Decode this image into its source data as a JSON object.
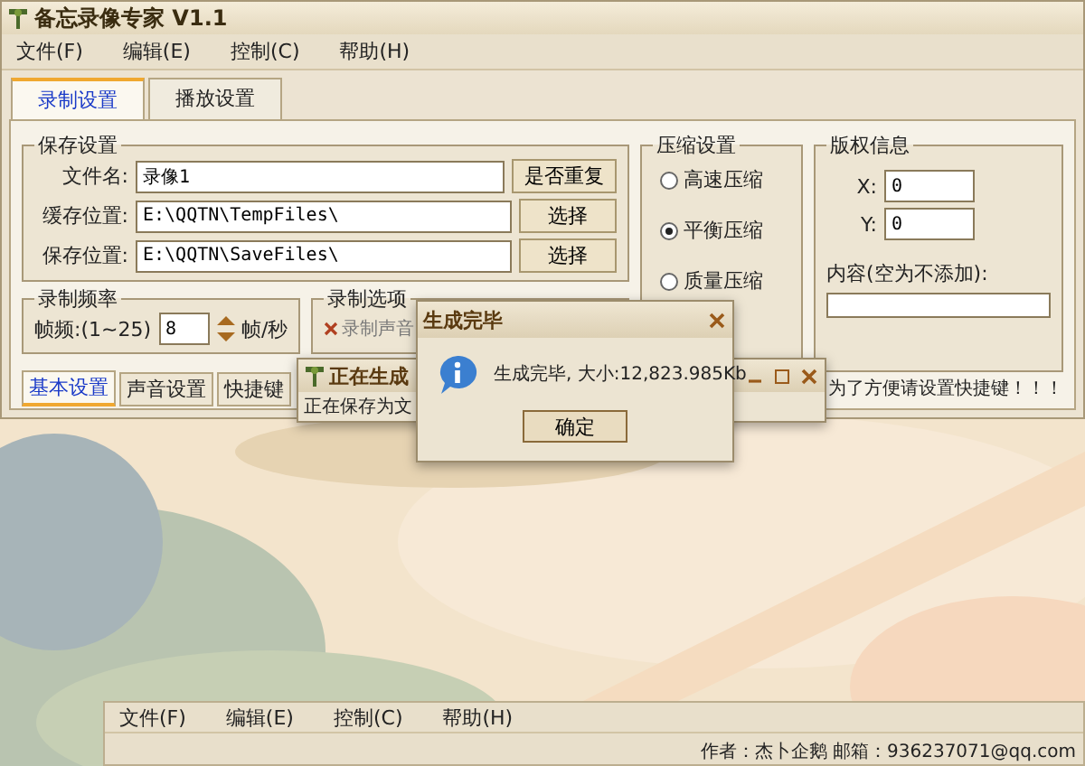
{
  "window": {
    "title": "备忘录像专家 V1.1"
  },
  "menu": [
    "文件(F)",
    "编辑(E)",
    "控制(C)",
    "帮助(H)"
  ],
  "tabs": [
    {
      "label": "录制设置",
      "selected": true
    },
    {
      "label": "播放设置",
      "selected": false
    }
  ],
  "save_settings": {
    "title": "保存设置",
    "fields": [
      {
        "label": "文件名:",
        "value": "录像1",
        "button": "是否重复"
      },
      {
        "label": "缓存位置:",
        "value": "E:\\QQTN\\TempFiles\\",
        "button": "选择"
      },
      {
        "label": "保存位置:",
        "value": "E:\\QQTN\\SaveFiles\\",
        "button": "选择"
      }
    ]
  },
  "frame_rate": {
    "title": "录制频率",
    "label": "帧频:(1~25)",
    "value": "8",
    "unit": "帧/秒"
  },
  "record_options": {
    "title": "录制选项",
    "items": [
      {
        "label": "录制声音",
        "checked": false
      }
    ]
  },
  "compression": {
    "title": "压缩设置",
    "options": [
      {
        "label": "高速压缩",
        "selected": false
      },
      {
        "label": "平衡压缩",
        "selected": true
      },
      {
        "label": "质量压缩",
        "selected": false
      }
    ]
  },
  "copyright": {
    "title": "版权信息",
    "x_label": "X:",
    "x_value": "0",
    "y_label": "Y:",
    "y_value": "0",
    "content_label": "内容(空为不添加):"
  },
  "bottom_tabs": [
    {
      "label": "基本设置",
      "selected": true
    },
    {
      "label": "声音设置",
      "selected": false
    },
    {
      "label": "快捷键",
      "selected": false
    }
  ],
  "hint": "为了方便请设置快捷键！！！",
  "progress_window": {
    "title": "正在生成",
    "message": "正在保存为文"
  },
  "dialog": {
    "title": "生成完毕",
    "message": "生成完毕, 大小:12,823.985Kb",
    "button": "确定"
  },
  "back_window": {
    "menu": [
      "文件(F)",
      "编辑(E)",
      "控制(C)",
      "帮助(H)"
    ],
    "status": "作者：杰卜企鹅  邮箱：936237071@qq.com"
  }
}
